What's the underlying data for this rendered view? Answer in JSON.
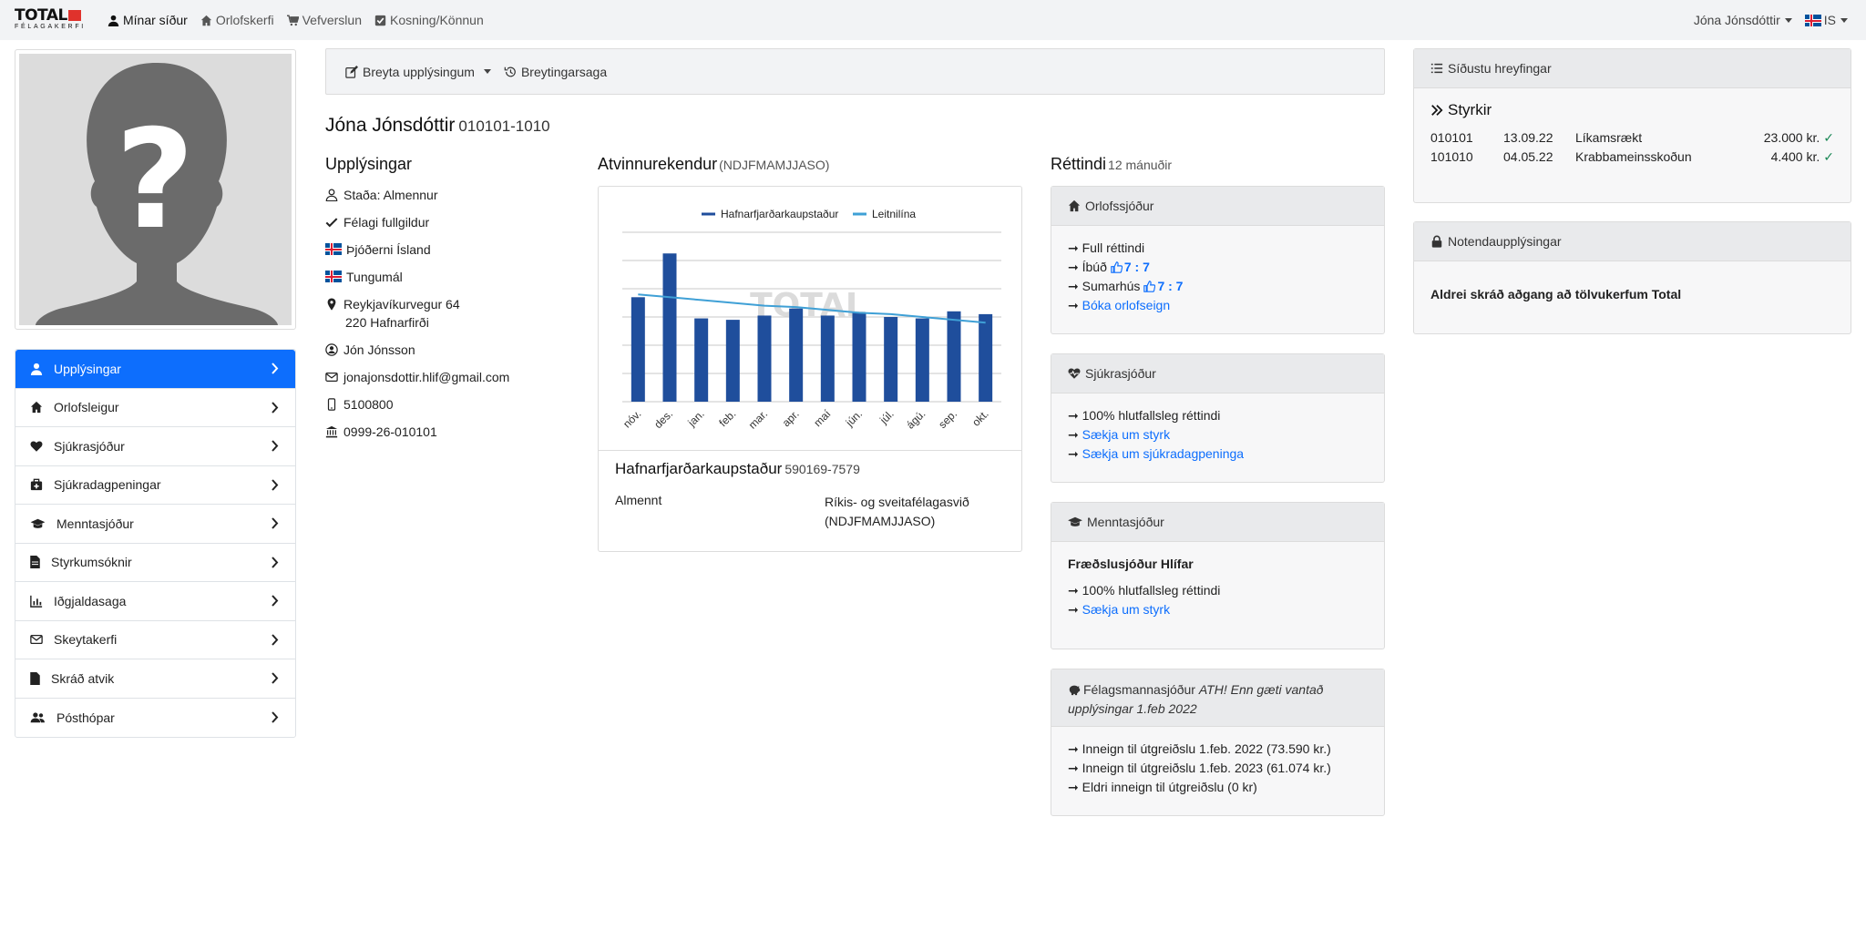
{
  "nav": {
    "logo_main": "TOTAL",
    "logo_sub": "FÉLAGAKERFI",
    "links": [
      {
        "label": "Mínar síður",
        "icon": "user-icon",
        "active": true
      },
      {
        "label": "Orlofskerfi",
        "icon": "home-icon"
      },
      {
        "label": "Vefverslun",
        "icon": "cart-icon"
      },
      {
        "label": "Kosning/Könnun",
        "icon": "checkbox-icon"
      }
    ],
    "user_name": "Jóna Jónsdóttir",
    "language": "IS"
  },
  "sidebar": {
    "items": [
      {
        "label": "Upplýsingar",
        "icon": "user-icon",
        "active": true
      },
      {
        "label": "Orlofsleigur",
        "icon": "home-icon"
      },
      {
        "label": "Sjúkrasjóður",
        "icon": "heart-icon"
      },
      {
        "label": "Sjúkradagpeningar",
        "icon": "medkit-icon"
      },
      {
        "label": "Menntasjóður",
        "icon": "graduation-cap-icon"
      },
      {
        "label": "Styrkumsóknir",
        "icon": "file-icon"
      },
      {
        "label": "Iðgjaldasaga",
        "icon": "bar-chart-icon"
      },
      {
        "label": "Skeytakerfi",
        "icon": "envelope-icon"
      },
      {
        "label": "Skráð atvik",
        "icon": "file-icon"
      },
      {
        "label": "Pósthópar",
        "icon": "users-icon"
      }
    ]
  },
  "toolbar": {
    "edit_label": "Breyta upplýsingum",
    "history_label": "Breytingarsaga"
  },
  "person": {
    "name": "Jóna Jónsdóttir",
    "kennitala": "010101-1010"
  },
  "info": {
    "title": "Upplýsingar",
    "status": "Staða: Almennur",
    "membership": "Félagi fullgildur",
    "nationality": "Þjóðerni Ísland",
    "language": "Tungumál",
    "address_line1": "Reykjavíkurvegur 64",
    "address_line2": "220 Hafnarfirði",
    "contact": "Jón Jónsson",
    "email": "jonajonsdottir.hlif@gmail.com",
    "phone": "5100800",
    "bank": "0999-26-010101"
  },
  "employers": {
    "title": "Atvinnurekendur",
    "subtitle": "(NDJFMAMJJASO)",
    "employer_name": "Hafnarfjarðarkaupstaður",
    "employer_kt": "590169-7579",
    "type": "Almennt",
    "union": "Ríkis- og sveitafélagasvið (NDJFMAMJJASO)"
  },
  "chart_data": {
    "type": "bar",
    "categories": [
      "nóv.",
      "des.",
      "jan.",
      "feb.",
      "mar.",
      "apr.",
      "maí",
      "jún.",
      "júl.",
      "ágú.",
      "sep.",
      "okt."
    ],
    "series": [
      {
        "name": "Hafnarfjarðarkaupstaður",
        "type": "bar",
        "color": "#1f4e9c",
        "values": [
          74,
          105,
          59,
          58,
          61,
          66,
          61,
          63,
          60,
          59,
          64,
          62
        ]
      },
      {
        "name": "Leitnilína",
        "type": "line",
        "color": "#3fa0d6",
        "values": [
          76,
          74,
          72,
          70,
          68,
          67,
          65,
          63,
          62,
          60,
          58,
          56
        ]
      }
    ],
    "ylim": [
      0,
      120
    ],
    "grid": true,
    "legend": "top",
    "watermark": "TOTAL"
  },
  "rights": {
    "title": "Réttindi",
    "subtitle": "12 mánuðir",
    "orlof": {
      "title": "Orlofssjóður",
      "full": "➞ Full réttindi",
      "ibud_label": "➞ Íbúð",
      "ibud_value": "7 : 7",
      "sumar_label": "➞ Sumarhús",
      "sumar_value": "7 : 7",
      "book_prefix": "➞",
      "book_link": "Bóka orlofseign"
    },
    "sjukra": {
      "title": "Sjúkrasjóður",
      "line1": "➞ 100% hlutfallsleg réttindi",
      "prefix": "➞",
      "link1": "Sækja um styrk",
      "link2": "Sækja um sjúkradagpeninga"
    },
    "mennta": {
      "title": "Menntasjóður",
      "fund": "Fræðslusjóður Hlífar",
      "line1": "➞ 100% hlutfallsleg réttindi",
      "prefix": "➞",
      "link1": "Sækja um styrk"
    },
    "felags": {
      "title": "Félagsmannasjóður",
      "note": "ATH! Enn gæti vantað upplýsingar 1.feb 2022",
      "line1": "➞ Inneign til útgreiðslu 1.feb. 2022 (73.590 kr.)",
      "line2": "➞ Inneign til útgreiðslu 1.feb. 2023 (61.074 kr.)",
      "line3": "➞ Eldri inneign til útgreiðslu (0 kr)"
    }
  },
  "recent": {
    "title": "Síðustu hreyfingar",
    "grants_title": "Styrkir",
    "grants": [
      {
        "id": "010101",
        "date": "13.09.22",
        "desc": "Líkamsrækt",
        "amount": "23.000 kr."
      },
      {
        "id": "101010",
        "date": "04.05.22",
        "desc": "Krabbameinsskoðun",
        "amount": "4.400 kr."
      }
    ]
  },
  "user_info": {
    "title": "Notendaupplýsingar",
    "message": "Aldrei skráð aðgang að tölvukerfum Total"
  }
}
